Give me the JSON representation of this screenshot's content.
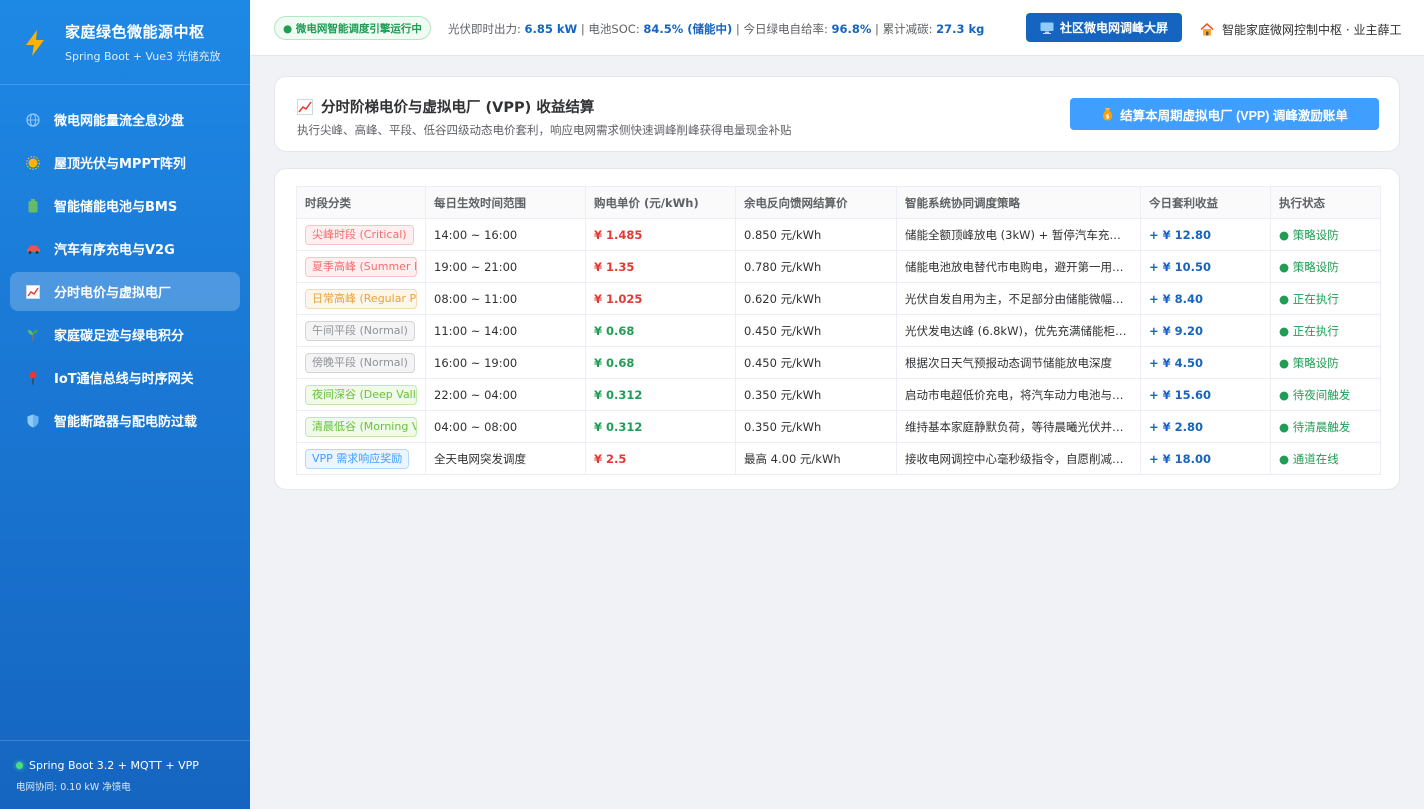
{
  "sidebar": {
    "brand_title": "家庭绿色微能源中枢",
    "brand_sub": "Spring Boot + Vue3 光储充放",
    "items": [
      {
        "label": "微电网能量流全息沙盘",
        "icon": "globe-icon"
      },
      {
        "label": "屋顶光伏与MPPT阵列",
        "icon": "sun-icon"
      },
      {
        "label": "智能储能电池与BMS",
        "icon": "battery-icon"
      },
      {
        "label": "汽车有序充电与V2G",
        "icon": "car-icon"
      },
      {
        "label": "分时电价与虚拟电厂",
        "icon": "chart-icon"
      },
      {
        "label": "家庭碳足迹与绿电积分",
        "icon": "seedling-icon"
      },
      {
        "label": "IoT通信总线与时序网关",
        "icon": "pin-icon"
      },
      {
        "label": "智能断路器与配电防过载",
        "icon": "shield-icon"
      }
    ],
    "footer_line1": "Spring Boot 3.2 + MQTT + VPP",
    "footer_line2": "电网协同: 0.10 kW 净馈电"
  },
  "header": {
    "status": "● 微电网智能调度引擎运行中",
    "pv_label": "光伏即时出力: ",
    "pv_value": "6.85 kW",
    "soc_label": " | 电池SOC: ",
    "soc_value": "84.5% (储能中)",
    "green_label": " | 今日绿电自给率: ",
    "green_value": "96.8%",
    "carbon_label": " | 累计减碳: ",
    "carbon_value": "27.3 kg",
    "screen_button": "社区微电网调峰大屏",
    "user": "智能家庭微网控制中枢 · 业主薛工"
  },
  "panel": {
    "title": "分时阶梯电价与虚拟电厂 (VPP) 收益结算",
    "subtitle": "执行尖峰、高峰、平段、低谷四级动态电价套利，响应电网需求侧快速调峰削峰获得电量现金补贴",
    "settle_button": "结算本周期虚拟电厂 (VPP) 调峰激励账单"
  },
  "table": {
    "headers": [
      "时段分类",
      "每日生效时间范围",
      "购电单价 (元/kWh)",
      "余电反向馈网结算价",
      "智能系统协同调度策略",
      "今日套利收益",
      "执行状态"
    ],
    "rows": [
      {
        "tag": "尖峰时段 (Critical)",
        "tag_color": "red",
        "time": "14:00 ~ 16:00",
        "price": "¥ 1.485",
        "price_color": "red",
        "feed": "0.850 元/kWh",
        "strategy": "储能全额顶峰放电 (3kW) + 暂停汽车充电…",
        "profit": "+ ¥ 12.80",
        "status": "● 策略设防"
      },
      {
        "tag": "夏季高峰 (Summer Peak)",
        "tag_color": "red",
        "time": "19:00 ~ 21:00",
        "price": "¥ 1.35",
        "price_color": "red",
        "feed": "0.780 元/kWh",
        "strategy": "储能电池放电替代市电购电，避开第一用…",
        "profit": "+ ¥ 10.50",
        "status": "● 策略设防"
      },
      {
        "tag": "日常高峰 (Regular Peak)",
        "tag_color": "orange",
        "time": "08:00 ~ 11:00",
        "price": "¥ 1.025",
        "price_color": "red",
        "feed": "0.620 元/kWh",
        "strategy": "光伏自发自用为主，不足部分由储能微幅…",
        "profit": "+ ¥ 8.40",
        "status": "● 正在执行"
      },
      {
        "tag": "午间平段 (Normal)",
        "tag_color": "gray",
        "time": "11:00 ~ 14:00",
        "price": "¥ 0.68",
        "price_color": "green",
        "feed": "0.450 元/kWh",
        "strategy": "光伏发电达峰 (6.8kW)，优先充满储能柜…",
        "profit": "+ ¥ 9.20",
        "status": "● 正在执行"
      },
      {
        "tag": "傍晚平段 (Normal)",
        "tag_color": "gray",
        "time": "16:00 ~ 19:00",
        "price": "¥ 0.68",
        "price_color": "green",
        "feed": "0.450 元/kWh",
        "strategy": "根据次日天气预报动态调节储能放电深度",
        "profit": "+ ¥ 4.50",
        "status": "● 策略设防"
      },
      {
        "tag": "夜间深谷 (Deep Valley)",
        "tag_color": "green",
        "time": "22:00 ~ 04:00",
        "price": "¥ 0.312",
        "price_color": "green",
        "feed": "0.350 元/kWh",
        "strategy": "启动市电超低价充电，将汽车动力电池与…",
        "profit": "+ ¥ 15.60",
        "status": "● 待夜间触发"
      },
      {
        "tag": "清晨低谷 (Morning Valley)",
        "tag_color": "green",
        "time": "04:00 ~ 08:00",
        "price": "¥ 0.312",
        "price_color": "green",
        "feed": "0.350 元/kWh",
        "strategy": "维持基本家庭静默负荷，等待晨曦光伏并…",
        "profit": "+ ¥ 2.80",
        "status": "● 待清晨触发"
      },
      {
        "tag": "VPP 需求响应奖励",
        "tag_color": "blue",
        "time": "全天电网突发调度",
        "price": "¥ 2.5",
        "price_color": "red",
        "feed": "最高 4.00 元/kWh",
        "strategy": "接收电网调控中心毫秒级指令，自愿削减…",
        "profit": "+ ¥ 18.00",
        "status": "● 通道在线"
      }
    ]
  }
}
